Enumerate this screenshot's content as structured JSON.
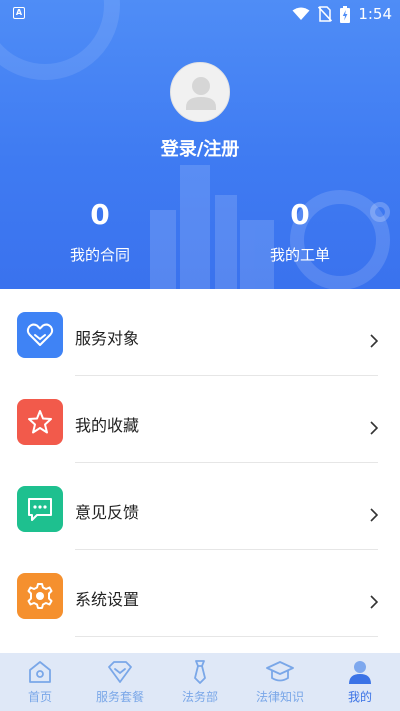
{
  "status_bar": {
    "app_badge": "A",
    "time": "1:54"
  },
  "profile": {
    "login_label": "登录/注册",
    "stats": [
      {
        "value": "0",
        "label": "我的合同"
      },
      {
        "value": "0",
        "label": "我的工单"
      }
    ]
  },
  "menu": {
    "items": [
      {
        "label": "服务对象",
        "icon": "heart-icon",
        "color": "#3f83f5"
      },
      {
        "label": "我的收藏",
        "icon": "star-icon",
        "color": "#f25a4b"
      },
      {
        "label": "意见反馈",
        "icon": "chat-icon",
        "color": "#1ec08f"
      },
      {
        "label": "系统设置",
        "icon": "gear-icon",
        "color": "#f5902e"
      }
    ]
  },
  "tabbar": {
    "tabs": [
      {
        "label": "首页",
        "icon": "home-icon",
        "active": false
      },
      {
        "label": "服务套餐",
        "icon": "diamond-icon",
        "active": false
      },
      {
        "label": "法务部",
        "icon": "tie-icon",
        "active": false
      },
      {
        "label": "法律知识",
        "icon": "graduation-cap-icon",
        "active": false
      },
      {
        "label": "我的",
        "icon": "user-icon",
        "active": true
      }
    ]
  },
  "colors": {
    "header_blue": "#4f8df6",
    "tab_active": "#3b73e6",
    "tab_inactive": "#7aa7e8"
  }
}
